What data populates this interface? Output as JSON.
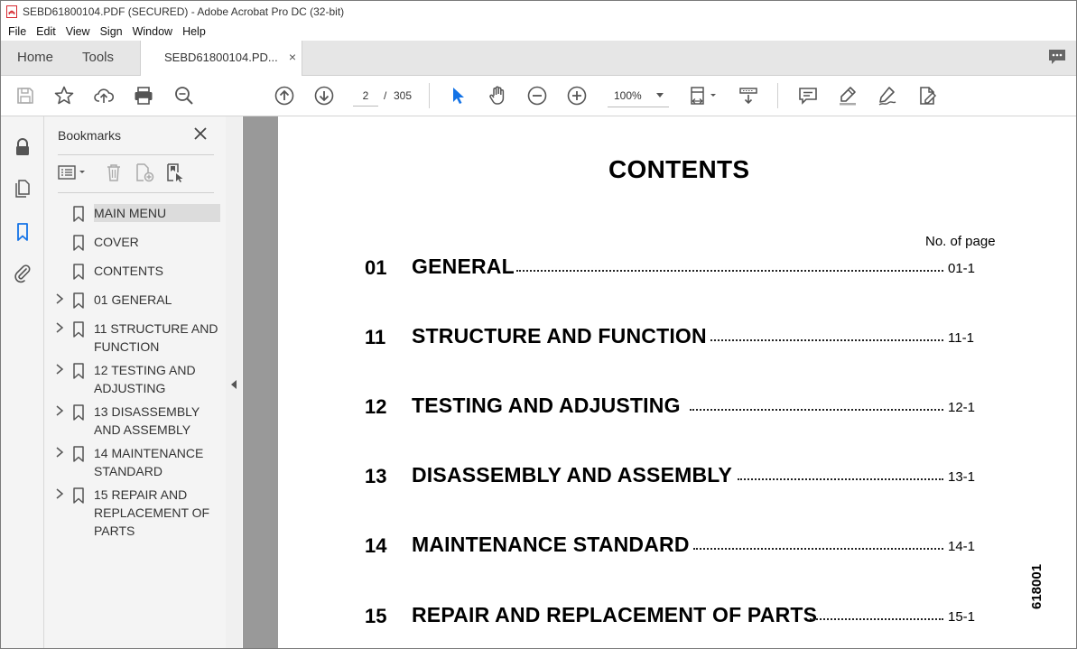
{
  "window": {
    "title": "SEBD61800104.PDF (SECURED) - Adobe Acrobat Pro DC (32-bit)"
  },
  "menu": [
    "File",
    "Edit",
    "View",
    "Sign",
    "Window",
    "Help"
  ],
  "tabs": {
    "home": "Home",
    "tools": "Tools",
    "document": "SEBD61800104.PD...",
    "close_glyph": "×"
  },
  "toolbar": {
    "current_page": "2",
    "page_separator": "/",
    "page_count": "305",
    "zoom": "100%"
  },
  "bookmarks": {
    "title": "Bookmarks",
    "items": [
      {
        "label": "MAIN MENU",
        "expandable": false,
        "selected": true
      },
      {
        "label": "COVER",
        "expandable": false,
        "selected": false
      },
      {
        "label": "CONTENTS",
        "expandable": false,
        "selected": false
      },
      {
        "label": "01 GENERAL",
        "expandable": true,
        "selected": false
      },
      {
        "label": "11 STRUCTURE AND FUNCTION",
        "expandable": true,
        "selected": false
      },
      {
        "label": "12 TESTING AND ADJUSTING",
        "expandable": true,
        "selected": false
      },
      {
        "label": "13 DISASSEMBLY AND ASSEMBLY",
        "expandable": true,
        "selected": false
      },
      {
        "label": "14 MAINTENANCE STANDARD",
        "expandable": true,
        "selected": false
      },
      {
        "label": "15 REPAIR AND REPLACEMENT OF PARTS",
        "expandable": true,
        "selected": false
      }
    ]
  },
  "document": {
    "heading": "CONTENTS",
    "page_column_label": "No. of page",
    "side_code": "618001",
    "entries": [
      {
        "number": "01",
        "title": "GENERAL",
        "page": "01-1"
      },
      {
        "number": "11",
        "title": "STRUCTURE AND FUNCTION",
        "page": "11-1"
      },
      {
        "number": "12",
        "title": "TESTING AND ADJUSTING",
        "page": "12-1"
      },
      {
        "number": "13",
        "title": "DISASSEMBLY AND ASSEMBLY",
        "page": "13-1"
      },
      {
        "number": "14",
        "title": "MAINTENANCE STANDARD",
        "page": "14-1"
      },
      {
        "number": "15",
        "title": "REPAIR AND REPLACEMENT OF PARTS",
        "page": "15-1"
      }
    ]
  },
  "colors": {
    "accent": "#1473e6",
    "app_red": "#d7282f",
    "icon_gray": "#555555",
    "doc_background": "#999999"
  }
}
